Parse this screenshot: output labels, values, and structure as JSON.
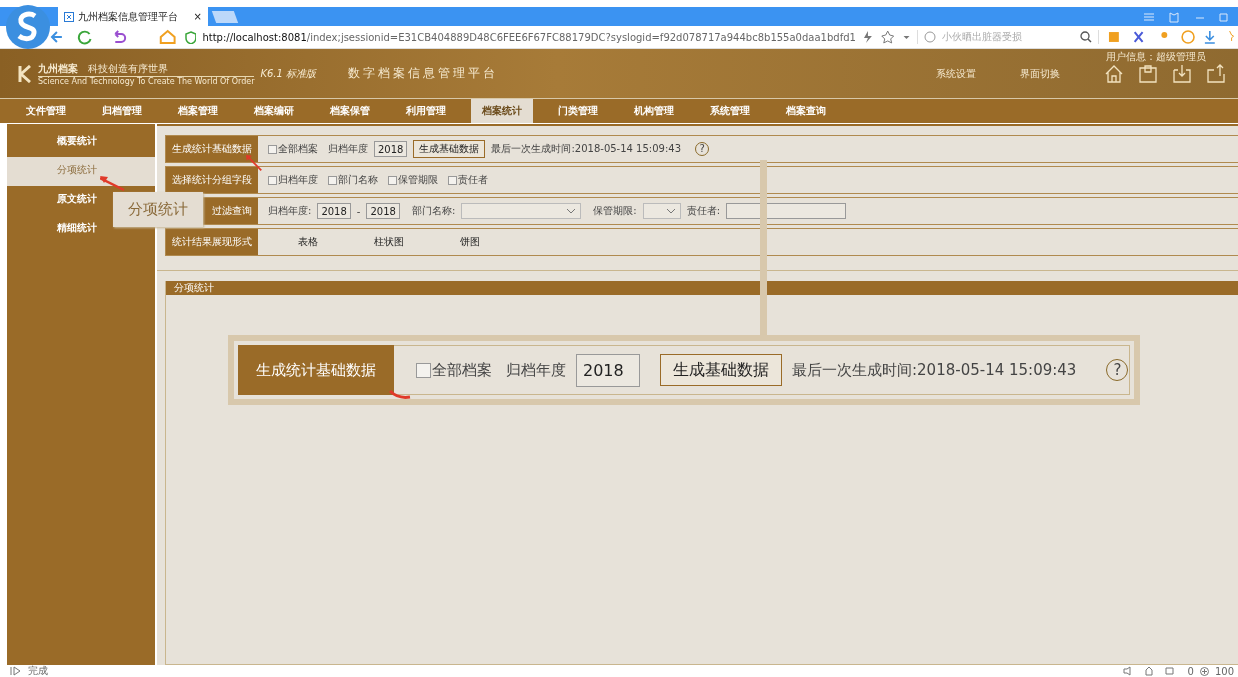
{
  "browser": {
    "tab_title": "九州档案信息管理平台",
    "tab_close": "×",
    "url_host": "http://localhost:8081",
    "url_path": "/index;jsessionid=E31CB404889D48C6FEE6F67FC88179DC?syslogid=f92d078717a944bc8b155a0daa1bdfd1",
    "search_placeholder": "小伙晒出脏器受损"
  },
  "header": {
    "brand": "九州档案",
    "slogan": "科技创造有序世界",
    "tagline": "Science And Technology To Create The World Of Order",
    "version": "K6.1 标准版",
    "title": "数字档案信息管理平台",
    "user_info": "用户信息：超级管理员",
    "links": [
      "系统设置",
      "界面切换"
    ]
  },
  "nav": [
    {
      "label": "文件管理",
      "selected": false
    },
    {
      "label": "归档管理",
      "selected": false
    },
    {
      "label": "档案管理",
      "selected": false
    },
    {
      "label": "档案编研",
      "selected": false
    },
    {
      "label": "档案保管",
      "selected": false
    },
    {
      "label": "利用管理",
      "selected": false
    },
    {
      "label": "档案统计",
      "selected": true
    },
    {
      "label": "门类管理",
      "selected": false
    },
    {
      "label": "机构管理",
      "selected": false
    },
    {
      "label": "系统管理",
      "selected": false
    },
    {
      "label": "档案查询",
      "selected": false
    }
  ],
  "sidebar": [
    {
      "label": "概要统计",
      "selected": false
    },
    {
      "label": "分项统计",
      "selected": true
    },
    {
      "label": "原文统计",
      "selected": false
    },
    {
      "label": "精细统计",
      "selected": false
    }
  ],
  "rows": [
    {
      "kind": "generate",
      "label": "生成统计基础数据",
      "checkbox": {
        "label": "全部档案",
        "checked": false
      },
      "year_label": "归档年度",
      "year": "2018",
      "button": "生成基础数据",
      "last_time": "最后一次生成时间:2018-05-14 15:09:43",
      "help": "?"
    },
    {
      "kind": "group",
      "label": "选择统计分组字段",
      "checkboxes": [
        {
          "label": "归档年度",
          "checked": false
        },
        {
          "label": "部门名称",
          "checked": false
        },
        {
          "label": "保管期限",
          "checked": false
        },
        {
          "label": "责任者",
          "checked": false
        }
      ]
    },
    {
      "kind": "filter",
      "label": "过滤查询",
      "year_label": "归档年度:",
      "year_from": "2018",
      "separator": "-",
      "year_to": "2018",
      "dept_label": "部门名称:",
      "period_label": "保管期限:",
      "person_label": "责任者:"
    },
    {
      "kind": "display",
      "label": "统计结果展现形式",
      "options": [
        "表格",
        "柱状图",
        "饼图"
      ]
    }
  ],
  "panel": {
    "title": "分项统计"
  },
  "callouts": {
    "sidebar_zoom": "分项统计",
    "inset": {
      "label": "生成统计基础数据",
      "checkbox": {
        "label": "全部档案",
        "checked": false
      },
      "year_label": "归档年度",
      "year": "2018",
      "button": "生成基础数据",
      "last_time": "最后一次生成时间:2018-05-14 15:09:43",
      "help": "?"
    }
  },
  "status_bar": {
    "text": "完成",
    "count": "0",
    "zoom": "100"
  }
}
